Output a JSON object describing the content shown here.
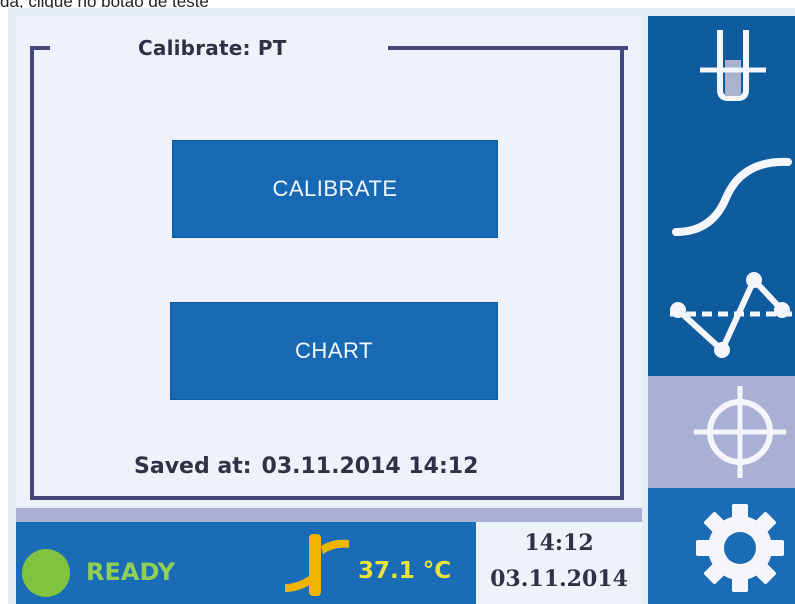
{
  "caption": "da, clique no botão de teste",
  "screen": {
    "title": "Calibrate: PT",
    "buttons": {
      "calibrate": "CALIBRATE",
      "chart": "CHART"
    },
    "saved_label": "Saved at:",
    "saved_value": "03.11.2014 14:12"
  },
  "status_bar": {
    "state": "READY",
    "temperature": "37.1 °C",
    "time": "14:12",
    "date": "03.11.2014"
  },
  "side_icons": [
    "probe-icon",
    "curve-icon",
    "chart-line-icon",
    "target-icon",
    "gear-icon"
  ],
  "colors": {
    "button_blue": "#1869b4",
    "panel_dark_blue": "#0e5b9e",
    "ready_green": "#7fc341",
    "temperature_yellow": "#e8e23b"
  }
}
